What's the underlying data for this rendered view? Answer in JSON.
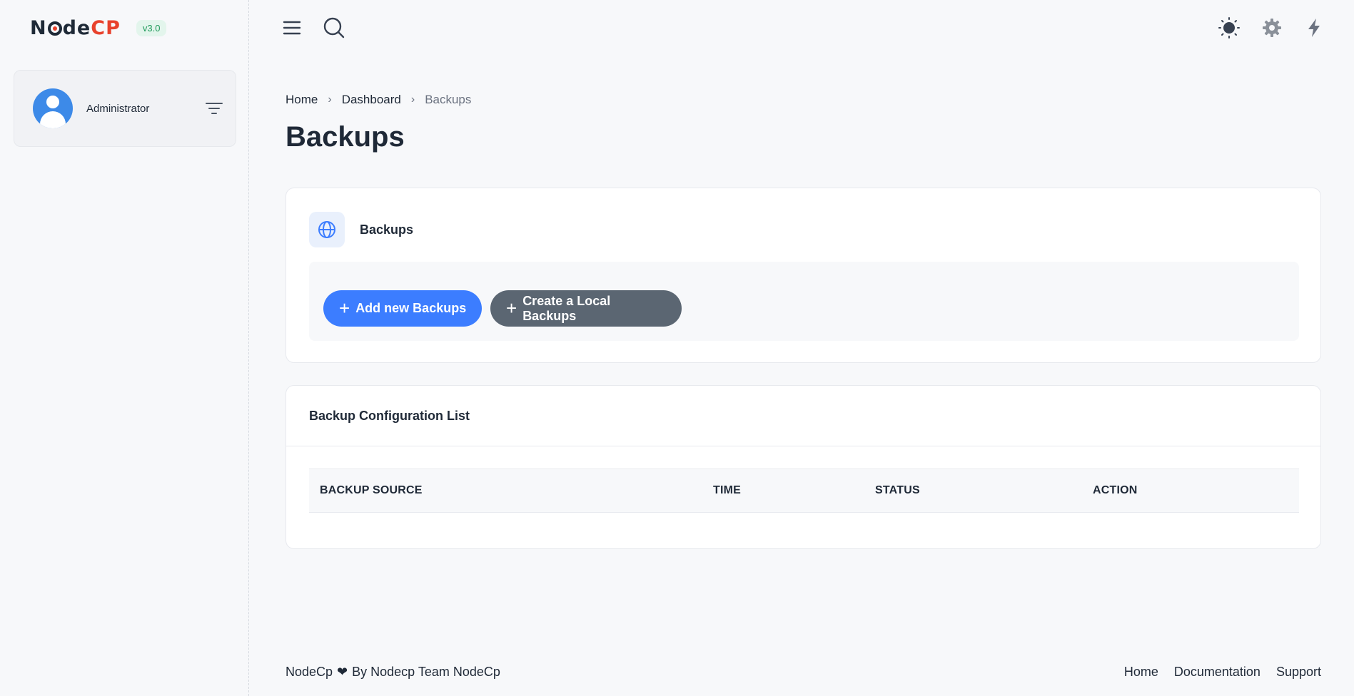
{
  "brand": {
    "logo_text_dark": "Node",
    "logo_text_accent": "CP",
    "version": "v3.0",
    "accent_color": "#e8412c"
  },
  "sidebar": {
    "user": {
      "name": "Administrator",
      "avatar_icon": "user-avatar-icon",
      "filter_icon": "filter-icon"
    }
  },
  "topbar": {
    "menu_icon": "hamburger-menu-icon",
    "search_icon": "search-icon",
    "theme_icon": "sun-icon",
    "settings_icon": "gear-icon",
    "quick_icon": "lightning-icon"
  },
  "breadcrumb": {
    "items": [
      "Home",
      "Dashboard",
      "Backups"
    ]
  },
  "page": {
    "title": "Backups"
  },
  "actions_card": {
    "title": "Backups",
    "icon": "globe-icon",
    "buttons": {
      "add_label": "Add new Backups",
      "local_label": "Create a Local Backups"
    },
    "colors": {
      "primary": "#3c7dff",
      "secondary": "#5b6672"
    }
  },
  "list_card": {
    "title": "Backup Configuration List",
    "columns": [
      "BACKUP SOURCE",
      "TIME",
      "STATUS",
      "ACTION"
    ],
    "rows": []
  },
  "footer": {
    "left_prefix": "NodeCp",
    "left_suffix": "By Nodecp Team NodeCp",
    "links": [
      "Home",
      "Documentation",
      "Support"
    ]
  }
}
